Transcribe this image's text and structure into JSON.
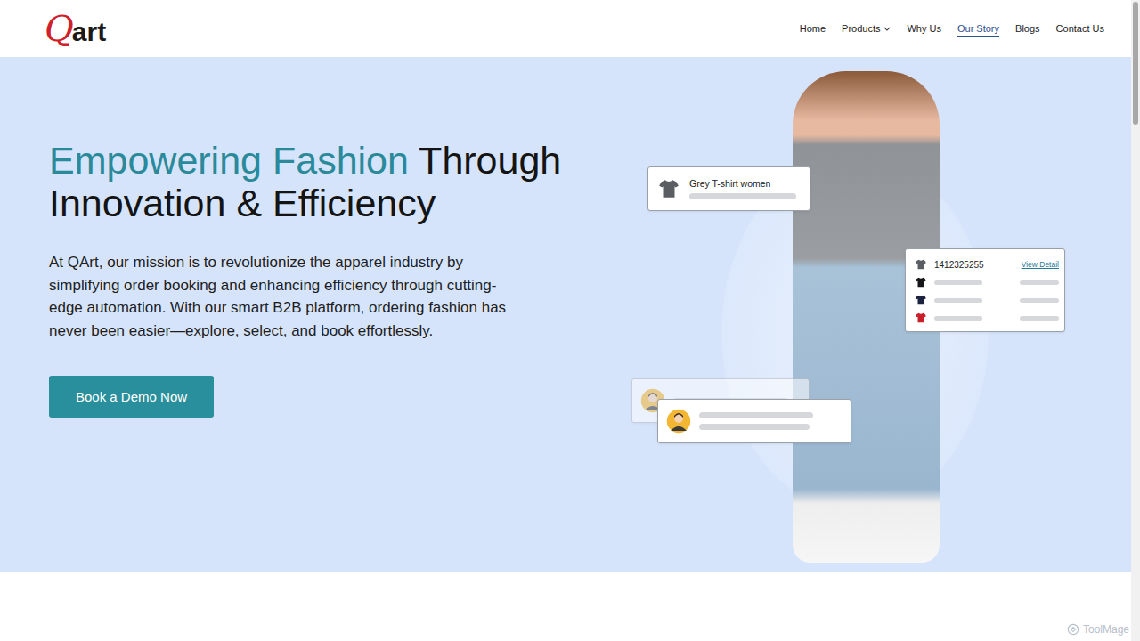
{
  "logo": {
    "mark": "Q",
    "text": "art"
  },
  "nav": [
    {
      "label": "Home",
      "selected": false,
      "has_menu": false
    },
    {
      "label": "Products",
      "selected": false,
      "has_menu": true
    },
    {
      "label": "Why Us",
      "selected": false,
      "has_menu": false
    },
    {
      "label": "Our Story",
      "selected": true,
      "has_menu": false
    },
    {
      "label": "Blogs",
      "selected": false,
      "has_menu": false
    },
    {
      "label": "Contact Us",
      "selected": false,
      "has_menu": false
    }
  ],
  "hero": {
    "title_accent": "Empowering Fashion",
    "title_rest": "Through Innovation & Efficiency",
    "description": "At QArt, our mission is to revolutionize the apparel industry by simplifying order booking and enhancing efficiency through cutting-edge automation. With our smart B2B platform, ordering fashion has never been easier—explore, select, and book effortlessly.",
    "button": "Book a Demo Now"
  },
  "product_card": {
    "label": "Grey T-shirt women",
    "color": "#5a5e63"
  },
  "detail_card": {
    "order": "1412325255",
    "link": "View Detail",
    "rows": [
      {
        "color": "#5a5e63"
      },
      {
        "color": "#15161a"
      },
      {
        "color": "#1c2340"
      },
      {
        "color": "#c8202a"
      }
    ]
  },
  "contacts": [
    {
      "faded": true
    },
    {
      "faded": false
    }
  ],
  "watermark": "ToolMage"
}
